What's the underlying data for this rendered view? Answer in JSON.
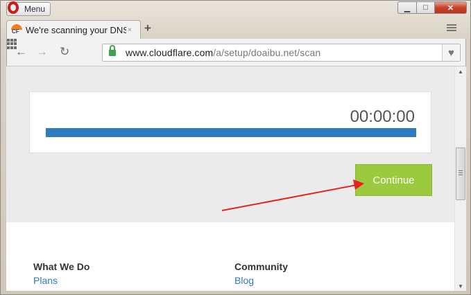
{
  "window": {
    "menu_label": "Menu",
    "minimize_glyph": "▁",
    "maximize_glyph": "□",
    "close_glyph": "✕"
  },
  "tabs": [
    {
      "title": "We're scanning your DNS r",
      "favicon_text": "CF",
      "close_glyph": "×",
      "active": true
    }
  ],
  "new_tab_glyph": "+",
  "toolbar": {
    "back_glyph": "←",
    "forward_glyph": "→",
    "reload_glyph": "↻",
    "url_host": "www.cloudflare.com",
    "url_path": "/a/setup/doaibu.net/scan",
    "bookmark_glyph": "♥"
  },
  "page": {
    "timer": "00:00:00",
    "progress": 1.0,
    "progress_color": "#2f7bbf",
    "continue_label": "Continue",
    "continue_color": "#9bca3e",
    "footer": {
      "col1_head": "What We Do",
      "col1_link": "Plans",
      "col2_head": "Community",
      "col2_link": "Blog"
    },
    "annotation_arrow_color": "#e8231f"
  },
  "scrollbar": {
    "up_glyph": "▲",
    "down_glyph": "▼"
  }
}
